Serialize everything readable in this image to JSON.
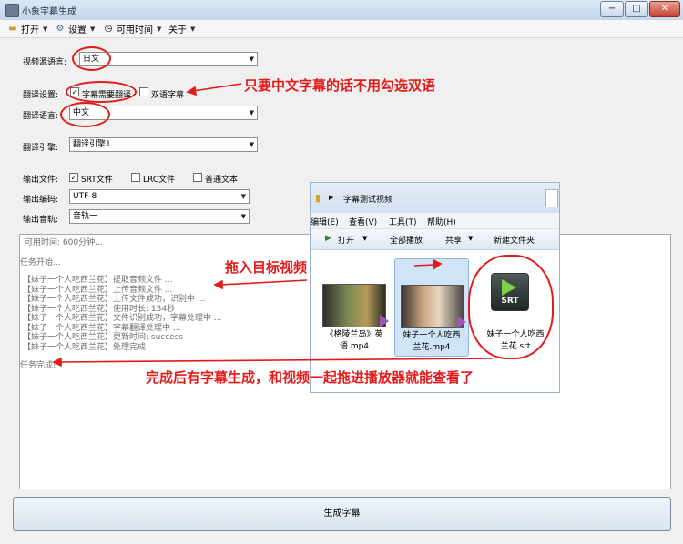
{
  "window": {
    "title": "小象字幕生成",
    "min": "−",
    "max": "□",
    "close": "✕"
  },
  "menu": [
    {
      "label": "打开",
      "icon": "folder-icon"
    },
    {
      "label": "设置",
      "icon": "gear-icon"
    },
    {
      "label": "可用时间",
      "icon": "clock-icon"
    },
    {
      "label": "关于",
      "icon": ""
    }
  ],
  "form": {
    "source_lang_label": "视频源语言:",
    "source_lang_value": "日文",
    "translate_setting_label": "翻译设置:",
    "need_translate_label": "字幕需要翻译",
    "need_translate_checked": true,
    "bilingual_label": "双语字幕",
    "bilingual_checked": false,
    "target_lang_label": "翻译语言:",
    "target_lang_value": "中文",
    "engine_label": "翻译引擎:",
    "engine_value": "翻译引擎1",
    "output_file_label": "输出文件:",
    "srt_label": "SRT文件",
    "srt_checked": true,
    "lrc_label": "LRC文件",
    "lrc_checked": false,
    "txt_label": "普通文本",
    "txt_checked": false,
    "encoding_label": "输出编码:",
    "encoding_value": "UTF-8",
    "audio_track_label": "输出音轨:",
    "audio_track_value": "音轨一"
  },
  "log": {
    "available_time": "可用时间: 600分钟...",
    "task_start": "任务开始...",
    "lines": [
      "【妹子一个人吃西兰花】提取音频文件 ...",
      "【妹子一个人吃西兰花】上传音频文件 ...",
      "【妹子一个人吃西兰花】上传文件成功，识别中 ...",
      "【妹子一个人吃西兰花】使用时长: 134秒",
      "【妹子一个人吃西兰花】文件识别成功，字幕处理中 ...",
      "【妹子一个人吃西兰花】字幕翻译处理中 ...",
      "【妹子一个人吃西兰花】更新时间: success",
      "【妹子一个人吃西兰花】处理完成"
    ],
    "task_done": "任务完成!"
  },
  "generate_button": "生成字幕",
  "explorer": {
    "folder": "字幕测试视频",
    "menu": [
      "编辑(E)",
      "查看(V)",
      "工具(T)",
      "帮助(H)"
    ],
    "toolbar": [
      "打开",
      "全部播放",
      "共享",
      "新建文件夹"
    ],
    "files": [
      {
        "name_line1": "《格陵兰岛》英",
        "name_line2": "语.mp4"
      },
      {
        "name_line1": "妹子一个人吃西",
        "name_line2": "兰花.mp4"
      },
      {
        "name_line1": "妹子一个人吃西",
        "name_line2": "兰花.srt",
        "badge": "SRT"
      }
    ]
  },
  "annotations": {
    "bilingual_note": "只要中文字幕的话不用勾选双语",
    "drag_note": "拖入目标视频",
    "done_note": "完成后有字幕生成，和视频一起拖进播放器就能查看了"
  },
  "colors": {
    "annotation_red": "#e31a1a",
    "window_bg": "#f0f0f0"
  }
}
